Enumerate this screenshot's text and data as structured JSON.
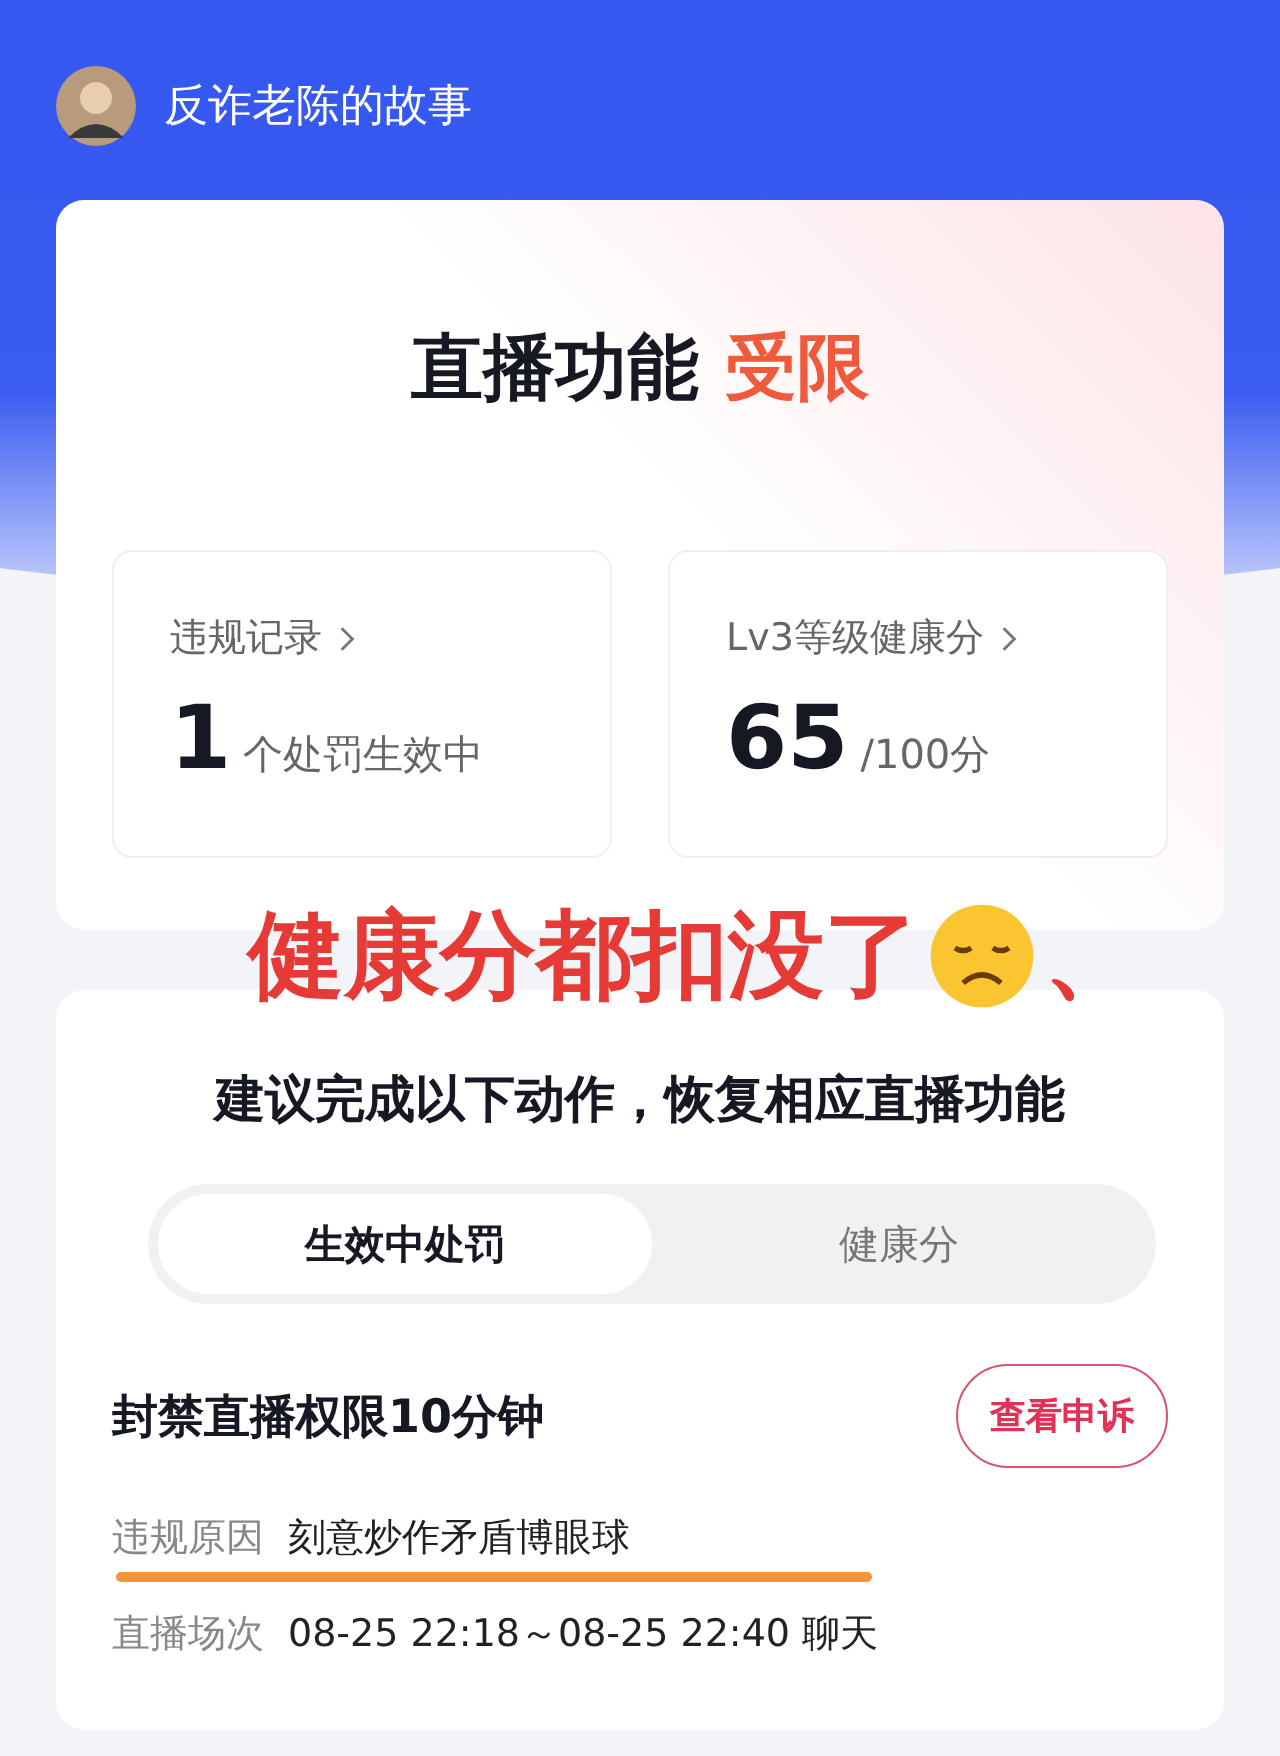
{
  "account": {
    "name": "反诈老陈的故事"
  },
  "status": {
    "title": "直播功能",
    "highlight": "受限"
  },
  "stats": [
    {
      "label": "违规记录",
      "value": "1",
      "unit": "个处罚生效中"
    },
    {
      "label": "Lv3等级健康分",
      "value": "65",
      "unit": "/100分"
    }
  ],
  "annotation": {
    "text": "健康分都扣没了",
    "trailing": "、"
  },
  "instruction": "建议完成以下动作，恢复相应直播功能",
  "tabs": [
    {
      "label": "生效中处罚",
      "selected": true
    },
    {
      "label": "健康分",
      "selected": false
    }
  ],
  "penalty": {
    "title": "封禁直播权限10分钟",
    "button": "查看申诉",
    "details": [
      {
        "label": "违规原因",
        "value": "刻意炒作矛盾博眼球",
        "underlined": true
      },
      {
        "label": "直播场次",
        "value": "08-25 22:18～08-25 22:40 聊天",
        "underlined": false
      }
    ]
  }
}
